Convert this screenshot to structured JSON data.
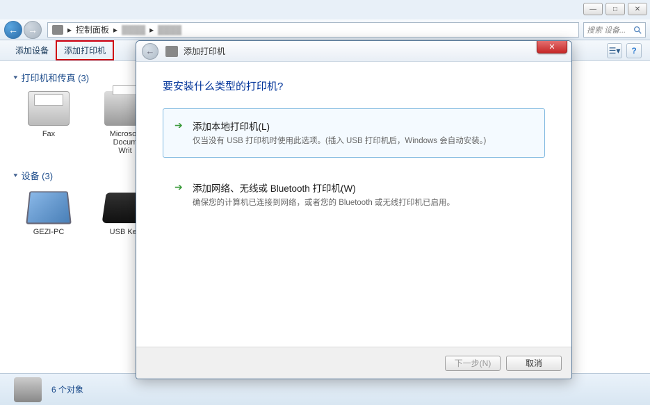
{
  "window_controls": {
    "min": "—",
    "max": "□",
    "close": "✕"
  },
  "nav": {
    "back_glyph": "←",
    "fwd_glyph": "→",
    "address_icon": "⎙",
    "address_root": "控制面板",
    "address_sep": "▸",
    "search_placeholder": "搜索 设备..."
  },
  "toolbar": {
    "add_device": "添加设备",
    "add_printer": "添加打印机"
  },
  "sections": {
    "printers": {
      "title": "打印机和传真 (3)"
    },
    "devices": {
      "title": "设备 (3)"
    }
  },
  "printer_items": [
    {
      "label": "Fax"
    },
    {
      "label": "Microsoft\nDocum\nWrit"
    }
  ],
  "device_items": [
    {
      "label": "GEZI-PC"
    },
    {
      "label": "USB Key"
    }
  ],
  "status": {
    "count_text": "6 个对象"
  },
  "dialog": {
    "title": "添加打印机",
    "close_glyph": "✕",
    "heading": "要安装什么类型的打印机?",
    "options": [
      {
        "arrow": "➔",
        "title": "添加本地打印机(L)",
        "desc": "仅当没有 USB 打印机时使用此选项。(插入 USB 打印机后，Windows 会自动安装。)",
        "selected": true
      },
      {
        "arrow": "➔",
        "title": "添加网络、无线或 Bluetooth 打印机(W)",
        "desc": "确保您的计算机已连接到网络，或者您的 Bluetooth 或无线打印机已启用。",
        "selected": false
      }
    ],
    "next_btn": "下一步(N)",
    "cancel_btn": "取消"
  }
}
